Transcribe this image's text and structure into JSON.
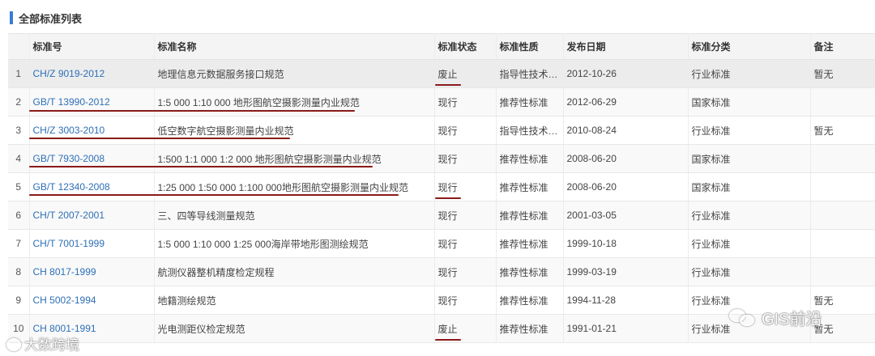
{
  "section": {
    "title": "全部标准列表"
  },
  "columns": [
    "",
    "标准号",
    "标准名称",
    "标准状态",
    "标准性质",
    "发布日期",
    "标准分类",
    "备注"
  ],
  "rows": [
    {
      "idx": "1",
      "code": "CH/Z 9019-2012",
      "name": "地理信息元数据服务接口规范",
      "status": "废止",
      "nature": "指导性技术…",
      "date": "2012-10-26",
      "category": "行业标准",
      "note": "暂无"
    },
    {
      "idx": "2",
      "code": "GB/T 13990-2012",
      "name": "1:5 000 1:10 000 地形图航空摄影测量内业规范",
      "status": "现行",
      "nature": "推荐性标准",
      "date": "2012-06-29",
      "category": "国家标准",
      "note": ""
    },
    {
      "idx": "3",
      "code": "CH/Z 3003-2010",
      "name": "低空数字航空摄影测量内业规范",
      "status": "现行",
      "nature": "指导性技术…",
      "date": "2010-08-24",
      "category": "行业标准",
      "note": "暂无"
    },
    {
      "idx": "4",
      "code": "GB/T 7930-2008",
      "name": "1:500 1:1 000 1:2 000 地形图航空摄影测量内业规范",
      "status": "现行",
      "nature": "推荐性标准",
      "date": "2008-06-20",
      "category": "国家标准",
      "note": ""
    },
    {
      "idx": "5",
      "code": "GB/T 12340-2008",
      "name": "1:25 000 1:50 000 1:100 000地形图航空摄影测量内业规范",
      "status": "现行",
      "nature": "推荐性标准",
      "date": "2008-06-20",
      "category": "国家标准",
      "note": ""
    },
    {
      "idx": "6",
      "code": "CH/T 2007-2001",
      "name": "三、四等导线测量规范",
      "status": "现行",
      "nature": "推荐性标准",
      "date": "2001-03-05",
      "category": "行业标准",
      "note": ""
    },
    {
      "idx": "7",
      "code": "CH/T 7001-1999",
      "name": "1:5 000 1:10 000 1:25 000海岸带地形图测绘规范",
      "status": "现行",
      "nature": "推荐性标准",
      "date": "1999-10-18",
      "category": "行业标准",
      "note": ""
    },
    {
      "idx": "8",
      "code": "CH 8017-1999",
      "name": "航测仪器整机精度检定规程",
      "status": "现行",
      "nature": "推荐性标准",
      "date": "1999-03-19",
      "category": "行业标准",
      "note": ""
    },
    {
      "idx": "9",
      "code": "CH 5002-1994",
      "name": "地籍测绘规范",
      "status": "现行",
      "nature": "推荐性标准",
      "date": "1994-11-28",
      "category": "行业标准",
      "note": "暂无"
    },
    {
      "idx": "10",
      "code": "CH 8001-1991",
      "name": "光电测距仪检定规范",
      "status": "废止",
      "nature": "推荐性标准",
      "date": "1991-01-21",
      "category": "行业标准",
      "note": "暂无"
    }
  ],
  "watermarks": {
    "left": "大数跨境",
    "right": "GIS前沿"
  },
  "colors": {
    "link": "#2d6fb7",
    "accent": "#3a7bd5",
    "annotation": "#8b1a1a"
  }
}
